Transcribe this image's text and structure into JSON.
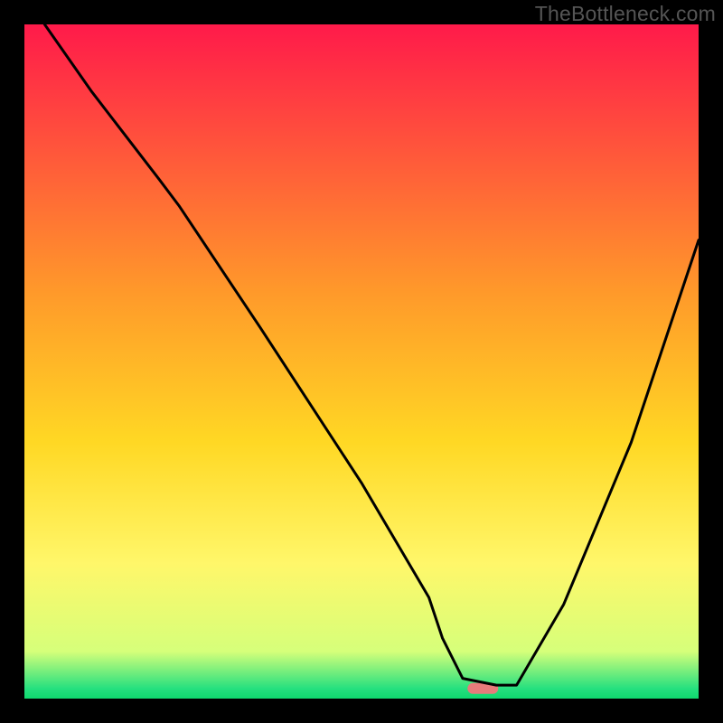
{
  "watermark": "TheBottleneck.com",
  "chart_data": {
    "type": "line",
    "title": "",
    "xlabel": "",
    "ylabel": "",
    "xlim": [
      0,
      100
    ],
    "ylim": [
      0,
      100
    ],
    "grid": false,
    "background": {
      "type": "vertical-gradient",
      "stops": [
        {
          "offset": 0.0,
          "color": "#ff1a4a"
        },
        {
          "offset": 0.4,
          "color": "#ff9a2a"
        },
        {
          "offset": 0.62,
          "color": "#ffd824"
        },
        {
          "offset": 0.8,
          "color": "#fff76a"
        },
        {
          "offset": 0.93,
          "color": "#d6ff7a"
        },
        {
          "offset": 0.985,
          "color": "#26e07f"
        },
        {
          "offset": 1.0,
          "color": "#0fd96e"
        }
      ]
    },
    "marker": {
      "shape": "rounded-rect",
      "x": 68,
      "y": 1.5,
      "color": "#e77b7b"
    },
    "series": [
      {
        "name": "curve",
        "color": "#000000",
        "x": [
          3,
          10,
          20,
          23,
          35,
          50,
          60,
          62,
          65,
          70,
          73,
          80,
          90,
          100
        ],
        "y": [
          100,
          90,
          77,
          73,
          55,
          32,
          15,
          9,
          3,
          2,
          2,
          14,
          38,
          68
        ]
      }
    ]
  }
}
